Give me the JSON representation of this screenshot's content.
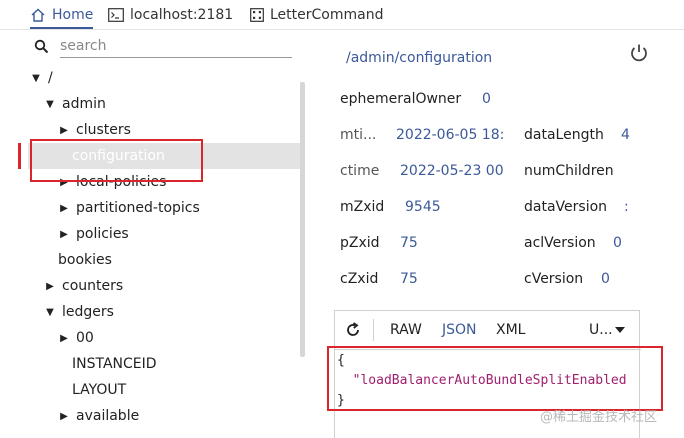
{
  "tabs": [
    {
      "label": "Home",
      "icon": "home-icon"
    },
    {
      "label": "localhost:2181",
      "icon": "terminal-icon"
    },
    {
      "label": "LetterCommand",
      "icon": "grid-icon"
    }
  ],
  "search": {
    "placeholder": "search"
  },
  "tree": [
    {
      "label": "/",
      "arrow": "▼"
    },
    {
      "label": "admin",
      "arrow": "▼"
    },
    {
      "label": "clusters",
      "arrow": "▶"
    },
    {
      "label": "configuration",
      "arrow": ""
    },
    {
      "label": "local-policies",
      "arrow": "▶"
    },
    {
      "label": "partitioned-topics",
      "arrow": "▶"
    },
    {
      "label": "policies",
      "arrow": "▶"
    },
    {
      "label": "bookies",
      "arrow": ""
    },
    {
      "label": "counters",
      "arrow": "▶"
    },
    {
      "label": "ledgers",
      "arrow": "▼"
    },
    {
      "label": "00",
      "arrow": "▶"
    },
    {
      "label": "INSTANCEID",
      "arrow": ""
    },
    {
      "label": "LAYOUT",
      "arrow": ""
    },
    {
      "label": "available",
      "arrow": "▶"
    }
  ],
  "detail": {
    "path": "/admin/configuration",
    "ephemeralOwner": {
      "key": "ephemeralOwner",
      "value": "0"
    },
    "mtime": {
      "key": "mti...",
      "value": "2022-06-05 18:"
    },
    "dataLength": {
      "key": "dataLength",
      "value": "4"
    },
    "ctime": {
      "key": "ctime",
      "value": "2022-05-23 00"
    },
    "numChildren": {
      "key": "numChildren",
      "value": ""
    },
    "mZxid": {
      "key": "mZxid",
      "value": "9545"
    },
    "dataVersion": {
      "key": "dataVersion",
      "value": ":"
    },
    "pZxid": {
      "key": "pZxid",
      "value": "75"
    },
    "aclVersion": {
      "key": "aclVersion",
      "value": "0"
    },
    "cZxid": {
      "key": "cZxid",
      "value": "75"
    },
    "cVersion": {
      "key": "cVersion",
      "value": "0"
    }
  },
  "editor": {
    "formats": [
      "RAW",
      "JSON",
      "XML"
    ],
    "active_format": "JSON",
    "charset": "U...",
    "code": {
      "open": "{",
      "line": "\"loadBalancerAutoBundleSplitEnabled",
      "close": "}"
    }
  },
  "watermark": "@稀土掘金技术社区",
  "colors": {
    "accent": "#3b5998",
    "highlight_box": "#d9262c",
    "selected_row": "#e3e3e3"
  }
}
